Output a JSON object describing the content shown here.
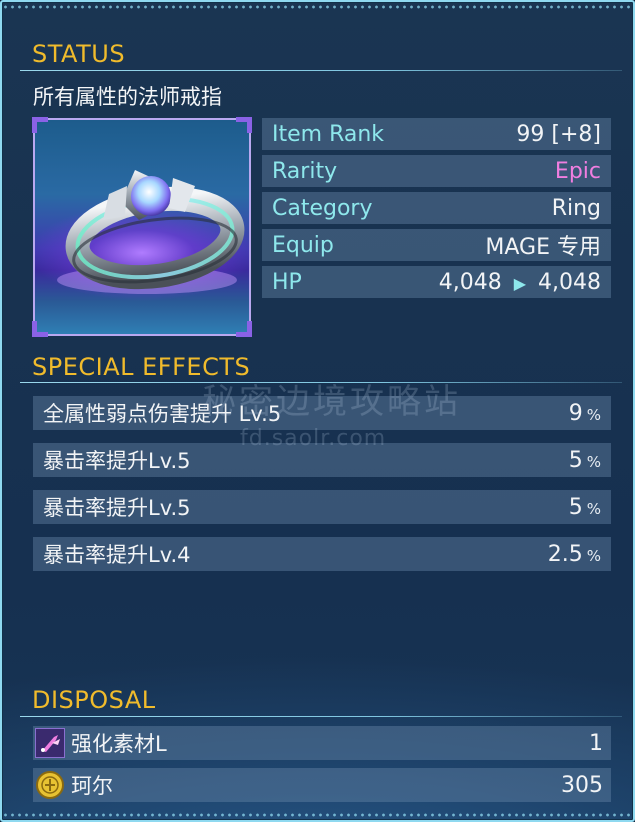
{
  "status": {
    "title": "STATUS",
    "item_name": "所有属性的法师戒指",
    "stats": [
      {
        "label": "Item Rank",
        "value": "99 [+8]"
      },
      {
        "label": "Rarity",
        "value": "Epic"
      },
      {
        "label": "Category",
        "value": "Ring"
      },
      {
        "label": "Equip",
        "value": "MAGE 专用"
      },
      {
        "label": "HP",
        "value_from": "4,048",
        "arrow": "▶",
        "value_to": "4,048"
      }
    ]
  },
  "special_effects": {
    "title": "SPECIAL EFFECTS",
    "items": [
      {
        "label": "全属性弱点伤害提升 Lv.5",
        "value": "9",
        "unit": "%"
      },
      {
        "label": "暴击率提升Lv.5",
        "value": "5",
        "unit": "%"
      },
      {
        "label": "暴击率提升Lv.5",
        "value": "5",
        "unit": "%"
      },
      {
        "label": "暴击率提升Lv.4",
        "value": "2.5",
        "unit": "%"
      }
    ]
  },
  "disposal": {
    "title": "DISPOSAL",
    "items": [
      {
        "icon": "enhance-material-icon",
        "label": "强化素材L",
        "value": "1"
      },
      {
        "icon": "coin-icon",
        "label": "珂尔",
        "value": "305"
      }
    ]
  },
  "watermark": {
    "line1": "秘密边境攻略站",
    "line2": "fd.saolr.com"
  },
  "colors": {
    "section_title": "#f0bb2c",
    "stat_label": "#8ee8ec",
    "rarity_epic": "#f07ee0",
    "frame_border": "#8fd9f0"
  }
}
